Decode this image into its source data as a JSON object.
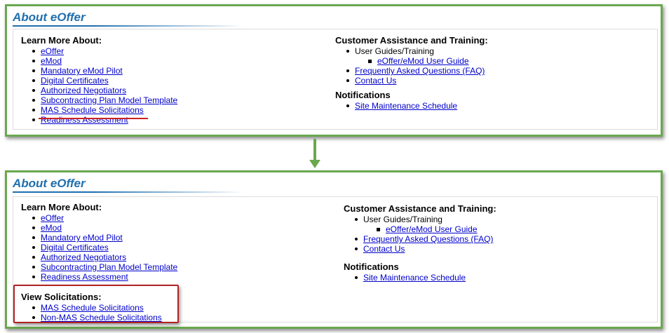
{
  "top_panel": {
    "title": "About eOffer",
    "learn_more": {
      "heading": "Learn More About:",
      "items": [
        "eOffer",
        "eMod",
        "Mandatory eMod Pilot",
        "Digital Certificates",
        "Authorized Negotiators",
        "Subcontracting Plan Model Template",
        "MAS Schedule Solicitations",
        "Readiness Assessment"
      ]
    },
    "customer_assistance": {
      "heading": "Customer Assistance and Training:",
      "items": [
        {
          "label": "User Guides/Training",
          "is_link": false,
          "sub_items": [
            "eOffer/eMod User Guide"
          ]
        },
        {
          "label": "Frequently Asked Questions (FAQ)",
          "is_link": true
        },
        {
          "label": "Contact Us",
          "is_link": true
        }
      ]
    },
    "notifications": {
      "heading": "Notifications",
      "items": [
        "Site Maintenance Schedule"
      ]
    }
  },
  "bottom_panel": {
    "title": "About eOffer",
    "learn_more": {
      "heading": "Learn More About:",
      "items": [
        "eOffer",
        "eMod",
        "Mandatory eMod Pilot",
        "Digital Certificates",
        "Authorized Negotiators",
        "Subcontracting Plan Model Template",
        "Readiness Assessment"
      ]
    },
    "view_solicitations": {
      "heading": "View Solicitations:",
      "items": [
        "MAS Schedule Solicitations",
        "Non-MAS Schedule Solicitations"
      ]
    },
    "customer_assistance": {
      "heading": "Customer Assistance and Training:",
      "items": [
        {
          "label": "User Guides/Training",
          "is_link": false,
          "sub_items": [
            "eOffer/eMod User Guide"
          ]
        },
        {
          "label": "Frequently Asked Questions (FAQ)",
          "is_link": true
        },
        {
          "label": "Contact Us",
          "is_link": true
        }
      ]
    },
    "notifications": {
      "heading": "Notifications",
      "items": [
        "Site Maintenance Schedule"
      ]
    }
  },
  "colors": {
    "panel_border": "#6aa84f",
    "title": "#1f6fae",
    "link": "#0000cc",
    "highlight": "#b22222"
  },
  "icons": {
    "transition_arrow": "arrow-down-icon"
  }
}
